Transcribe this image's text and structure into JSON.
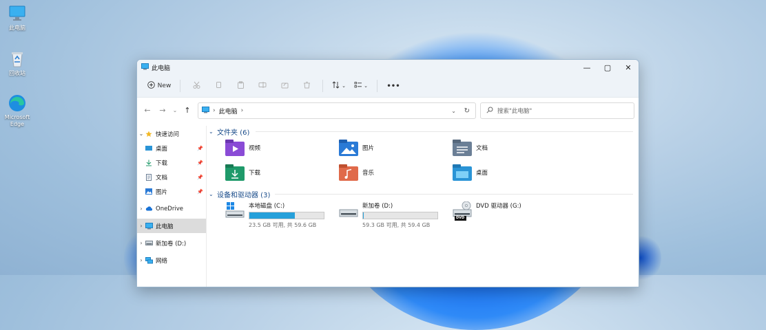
{
  "desktop": {
    "icons": [
      {
        "label": "此电脑",
        "icon": "this-pc-icon"
      },
      {
        "label": "回收站",
        "icon": "recycle-bin-icon"
      },
      {
        "label": "Microsoft Edge",
        "icon": "edge-icon"
      }
    ]
  },
  "window": {
    "title": "此电脑",
    "controls": {
      "minimize": "—",
      "maximize": "▢",
      "close": "✕"
    }
  },
  "toolbar": {
    "new_label": "New",
    "more": "•••"
  },
  "address": {
    "path": "此电脑",
    "separator": "›"
  },
  "search": {
    "placeholder": "搜索\"此电脑\""
  },
  "sidebar": {
    "items": [
      {
        "label": "快速访问",
        "icon": "star-icon",
        "expanded": true
      },
      {
        "label": "桌面",
        "icon": "desktop-folder-icon",
        "pinned": true
      },
      {
        "label": "下载",
        "icon": "download-icon",
        "pinned": true
      },
      {
        "label": "文档",
        "icon": "documents-icon",
        "pinned": true
      },
      {
        "label": "图片",
        "icon": "pictures-icon",
        "pinned": true
      },
      {
        "label": "OneDrive",
        "icon": "cloud-icon"
      },
      {
        "label": "此电脑",
        "icon": "this-pc-icon",
        "selected": true
      },
      {
        "label": "新加卷 (D:)",
        "icon": "drive-icon"
      },
      {
        "label": "网络",
        "icon": "network-icon"
      }
    ]
  },
  "folders_group": {
    "title": "文件夹 (6)",
    "items": [
      {
        "label": "视频",
        "color": "#8a4bd6"
      },
      {
        "label": "图片",
        "color": "#2a7ad6"
      },
      {
        "label": "文档",
        "color": "#6b7f96"
      },
      {
        "label": "下载",
        "color": "#1f9a6a"
      },
      {
        "label": "音乐",
        "color": "#e06a4a"
      },
      {
        "label": "桌面",
        "color": "#2a94d6"
      }
    ]
  },
  "drives_group": {
    "title": "设备和驱动器 (3)",
    "items": [
      {
        "label": "本地磁盘 (C:)",
        "free": "23.5 GB 可用, 共 59.6 GB",
        "used_fraction": 0.61
      },
      {
        "label": "新加卷 (D:)",
        "free": "59.3 GB 可用, 共 59.4 GB",
        "used_fraction": 0.01
      },
      {
        "label": "DVD 驱动器 (G:)",
        "dvd_badge": "DVD"
      }
    ]
  }
}
